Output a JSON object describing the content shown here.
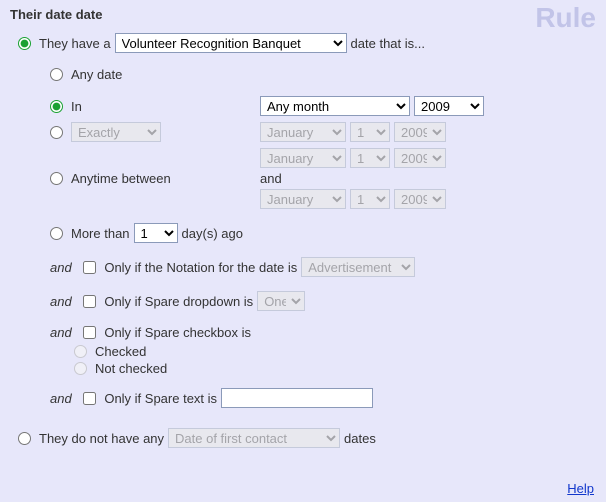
{
  "header": "Their date date",
  "watermark": "Rule",
  "main_options": {
    "have_label_pre": "They have a",
    "have_label_post": "date that is...",
    "date_type": "Volunteer Recognition Banquet",
    "not_have_label_pre": "They do not have any",
    "not_have_label_post": "dates",
    "not_have_type": "Date of first contact"
  },
  "filters": {
    "any_date": "Any date",
    "in_label": "In",
    "in_month": "Any month",
    "in_year": "2009",
    "exactly_sel": "Exactly",
    "anytime_label": "Anytime between",
    "more_than_pre": "More than",
    "more_than_val": "1",
    "more_than_post": "day(s) ago",
    "and_word": "and",
    "month_dis": "January",
    "day_dis": "1",
    "year_dis": "2009"
  },
  "conds": {
    "and": "and",
    "notation_label": "Only if the Notation for the date is",
    "notation_val": "Advertisement",
    "spare_dd_label": "Only if Spare dropdown is",
    "spare_dd_val": "One",
    "spare_cb_label": "Only if Spare checkbox is",
    "spare_cb_checked": "Checked",
    "spare_cb_notchecked": "Not checked",
    "spare_text_label": "Only if Spare text is"
  },
  "help": "Help"
}
